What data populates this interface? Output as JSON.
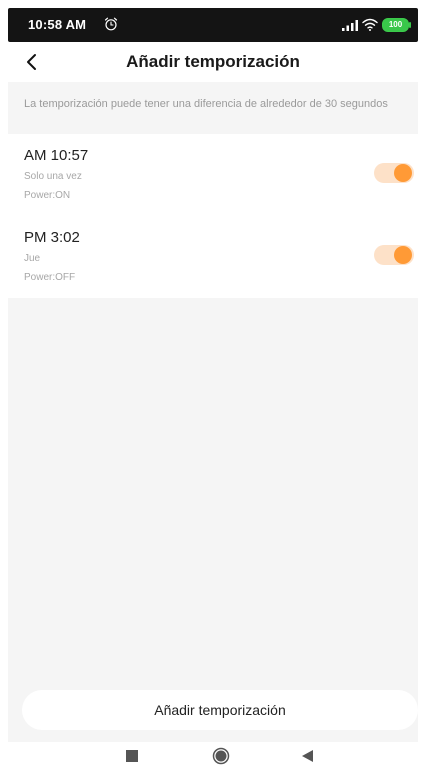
{
  "status_bar": {
    "time": "10:58 AM",
    "battery_level": "100",
    "icons": [
      "alarm-clock-icon",
      "signal-icon",
      "wifi-icon",
      "battery-icon"
    ]
  },
  "header": {
    "title": "Añadir temporización",
    "back_icon": "chevron-left-icon"
  },
  "notice": "La temporización puede tener una diferencia de alrededor de 30 segundos",
  "timers": [
    {
      "time": "AM 10:57",
      "repeat": "Solo una vez",
      "power": "Power:ON",
      "enabled": true
    },
    {
      "time": "PM 3:02",
      "repeat": "Jue",
      "power": "Power:OFF",
      "enabled": true
    }
  ],
  "add_button_label": "Añadir temporización",
  "nav_bar": {
    "icons": [
      "recent-apps-icon",
      "home-icon",
      "back-icon"
    ]
  },
  "colors": {
    "accent": "#ff9a36",
    "toggle_track": "#fde1c8",
    "battery": "#39c74a",
    "background": "#f5f5f5"
  }
}
